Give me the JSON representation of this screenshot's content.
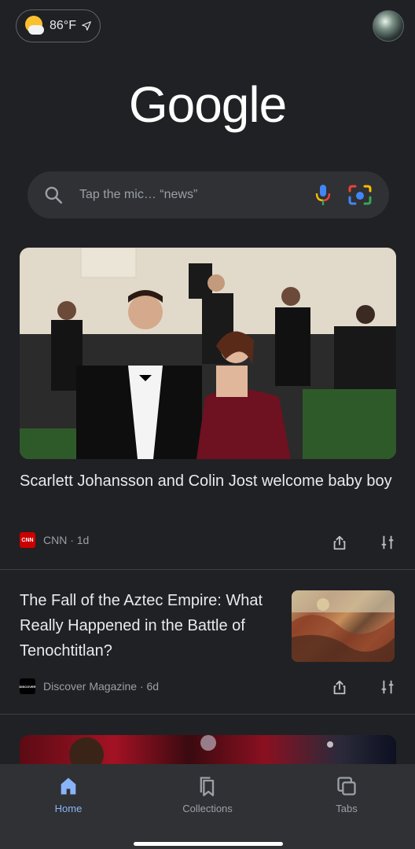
{
  "weather": {
    "temperature": "86°F",
    "icon": "partly-cloudy-icon"
  },
  "logo": {
    "text": "Google",
    "color": "#ffffff"
  },
  "search": {
    "placeholder": "Tap the mic… “news”"
  },
  "feed": {
    "articles": [
      {
        "title": "Scarlett Johansson and Colin Jost welcome baby boy",
        "source": "CNN",
        "source_logo_text": "CNN",
        "age": "1d",
        "meta": "CNN · 1d"
      },
      {
        "title": "The Fall of the Aztec Empire: What Really Happened in the Battle of Tenochtitlan?",
        "source": "Discover Magazine",
        "source_logo_text": "DISCOVER",
        "age": "6d",
        "meta": "Discover Magazine · 6d"
      }
    ]
  },
  "bottom_nav": {
    "items": [
      {
        "label": "Home",
        "active": true,
        "icon": "home-icon"
      },
      {
        "label": "Collections",
        "active": false,
        "icon": "bookmark-icon"
      },
      {
        "label": "Tabs",
        "active": false,
        "icon": "tabs-icon"
      }
    ]
  },
  "colors": {
    "background": "#202124",
    "surface": "#303134",
    "accent": "#8ab4f8",
    "cnn_red": "#cc0000"
  }
}
